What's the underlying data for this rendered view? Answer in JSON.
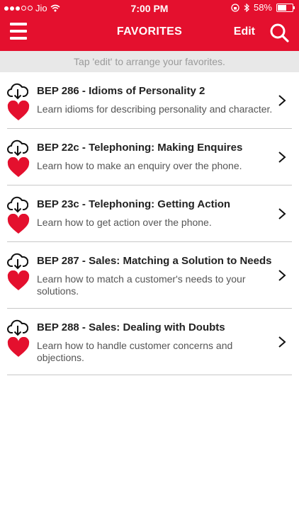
{
  "status_bar": {
    "carrier": "Jio",
    "time": "7:00 PM",
    "battery": "58%",
    "battery_level": 0.58
  },
  "header": {
    "title": "FAVORITES",
    "edit_label": "Edit",
    "menu_icon": "hamburger-icon",
    "search_icon": "search-icon"
  },
  "hint": "Tap 'edit' to arrange your favorites.",
  "colors": {
    "brand_red": "#e4102e",
    "hint_bg": "#e8e8e8",
    "divider": "#c8c8c8"
  },
  "favorites": [
    {
      "title": "BEP 286 - Idioms of Personality 2",
      "desc": "Learn idioms for describing personality and character."
    },
    {
      "title": "BEP 22c - Telephoning: Making Enquires",
      "desc": "Learn how to make an enquiry over the phone."
    },
    {
      "title": "BEP 23c - Telephoning: Getting Action",
      "desc": "Learn how to get action over the phone."
    },
    {
      "title": "BEP 287 - Sales: Matching a Solution to Needs",
      "desc": "Learn how to match a customer's needs to your solutions."
    },
    {
      "title": "BEP 288 - Sales: Dealing with Doubts",
      "desc": "Learn how to handle customer concerns and objections."
    }
  ]
}
